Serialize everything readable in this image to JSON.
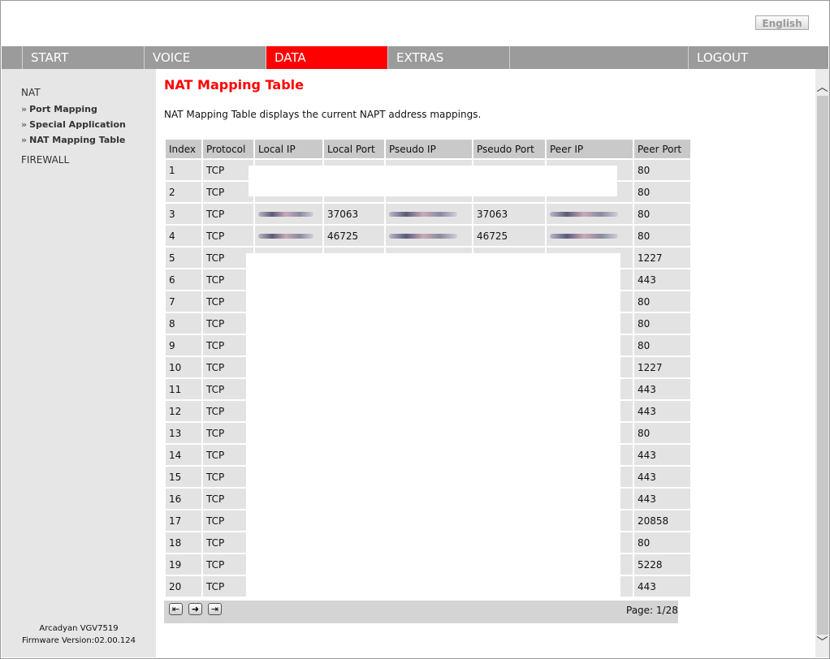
{
  "language_button": "English",
  "nav": {
    "tabs": [
      {
        "label": "START"
      },
      {
        "label": "VOICE"
      },
      {
        "label": "DATA"
      },
      {
        "label": "EXTRAS"
      },
      {
        "label": ""
      },
      {
        "label": "LOGOUT"
      }
    ],
    "active": "DATA"
  },
  "sidebar": {
    "section_nat": "NAT",
    "links": [
      {
        "label": "Port Mapping"
      },
      {
        "label": "Special Application"
      },
      {
        "label": "NAT Mapping Table"
      }
    ],
    "section_firewall": "FIREWALL",
    "model": "Arcadyan VGV7519",
    "firmware": "Firmware Version:02.00.124"
  },
  "main": {
    "title": "NAT Mapping Table",
    "description": "NAT Mapping Table displays the current NAPT address mappings.",
    "columns": [
      "Index",
      "Protocol",
      "Local IP",
      "Local Port",
      "Pseudo IP",
      "Pseudo Port",
      "Peer IP",
      "Peer Port"
    ],
    "rows": [
      {
        "index": "1",
        "protocol": "TCP",
        "local_port": "",
        "pseudo_port": "",
        "peer_port": "80"
      },
      {
        "index": "2",
        "protocol": "TCP",
        "local_port": "",
        "pseudo_port": "",
        "peer_port": "80"
      },
      {
        "index": "3",
        "protocol": "TCP",
        "local_port": "37063",
        "pseudo_port": "37063",
        "peer_port": "80"
      },
      {
        "index": "4",
        "protocol": "TCP",
        "local_port": "46725",
        "pseudo_port": "46725",
        "peer_port": "80"
      },
      {
        "index": "5",
        "protocol": "TCP",
        "local_port": "",
        "pseudo_port": "",
        "peer_port": "1227"
      },
      {
        "index": "6",
        "protocol": "TCP",
        "local_port": "",
        "pseudo_port": "",
        "peer_port": "443"
      },
      {
        "index": "7",
        "protocol": "TCP",
        "local_port": "",
        "pseudo_port": "",
        "peer_port": "80"
      },
      {
        "index": "8",
        "protocol": "TCP",
        "local_port": "",
        "pseudo_port": "",
        "peer_port": "80"
      },
      {
        "index": "9",
        "protocol": "TCP",
        "local_port": "",
        "pseudo_port": "",
        "peer_port": "80"
      },
      {
        "index": "10",
        "protocol": "TCP",
        "local_port": "",
        "pseudo_port": "",
        "peer_port": "1227"
      },
      {
        "index": "11",
        "protocol": "TCP",
        "local_port": "",
        "pseudo_port": "",
        "peer_port": "443"
      },
      {
        "index": "12",
        "protocol": "TCP",
        "local_port": "",
        "pseudo_port": "",
        "peer_port": "443"
      },
      {
        "index": "13",
        "protocol": "TCP",
        "local_port": "",
        "pseudo_port": "",
        "peer_port": "80"
      },
      {
        "index": "14",
        "protocol": "TCP",
        "local_port": "",
        "pseudo_port": "",
        "peer_port": "443"
      },
      {
        "index": "15",
        "protocol": "TCP",
        "local_port": "",
        "pseudo_port": "",
        "peer_port": "443"
      },
      {
        "index": "16",
        "protocol": "TCP",
        "local_port": "",
        "pseudo_port": "",
        "peer_port": "443"
      },
      {
        "index": "17",
        "protocol": "TCP",
        "local_port": "",
        "pseudo_port": "",
        "peer_port": "20858"
      },
      {
        "index": "18",
        "protocol": "TCP",
        "local_port": "",
        "pseudo_port": "",
        "peer_port": "80"
      },
      {
        "index": "19",
        "protocol": "TCP",
        "local_port": "",
        "pseudo_port": "",
        "peer_port": "5228"
      },
      {
        "index": "20",
        "protocol": "TCP",
        "local_port": "",
        "pseudo_port": "",
        "peer_port": "443"
      }
    ],
    "pager": {
      "first_icon": "first-page-icon",
      "next_icon": "next-page-icon",
      "last_icon": "last-page-icon",
      "page_label": "Page: 1/28"
    }
  },
  "colors": {
    "accent": "#ff0000",
    "nav_bg": "#9b9b9b",
    "sidebar_bg": "#e6e6e6"
  }
}
